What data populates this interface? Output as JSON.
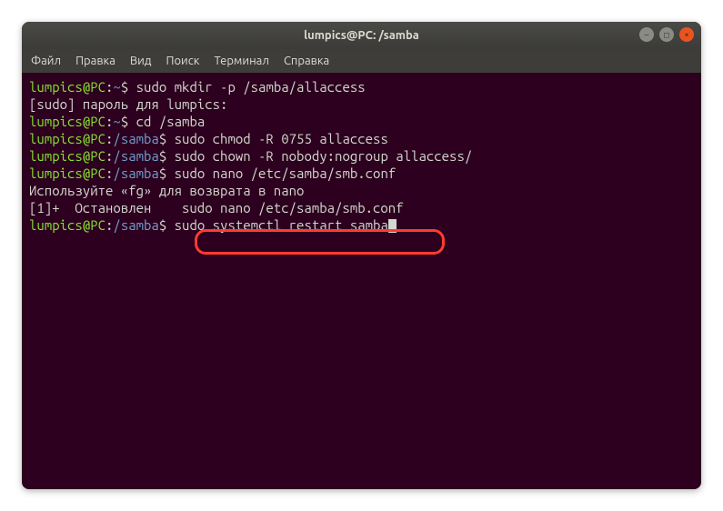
{
  "window": {
    "title": "lumpics@PC: /samba"
  },
  "menu": {
    "file": "Файл",
    "edit": "Правка",
    "view": "Вид",
    "search": "Поиск",
    "terminal": "Терминал",
    "help": "Справка"
  },
  "prompt": {
    "userhost": "lumpics@PC",
    "colon": ":",
    "home": "~",
    "samba": "/samba",
    "dollar": "$ "
  },
  "lines": {
    "l1_cmd": "sudo mkdir -p /samba/allaccess",
    "l2": "[sudo] пароль для lumpics:",
    "l3_cmd": "cd /samba",
    "l4_cmd": "sudo chmod -R 0755 allaccess",
    "l5_cmd": "sudo chown -R nobody:nogroup allaccess/",
    "l6_cmd": "sudo nano /etc/samba/smb.conf",
    "l7": "Используйте «fg» для возврата в nano",
    "l8": "",
    "l9": "[1]+  Остановлен    sudo nano /etc/samba/smb.conf",
    "l10_cmd": "sudo systemctl restart samba"
  },
  "icons": {
    "min": "—",
    "max": "□",
    "close": "×"
  }
}
